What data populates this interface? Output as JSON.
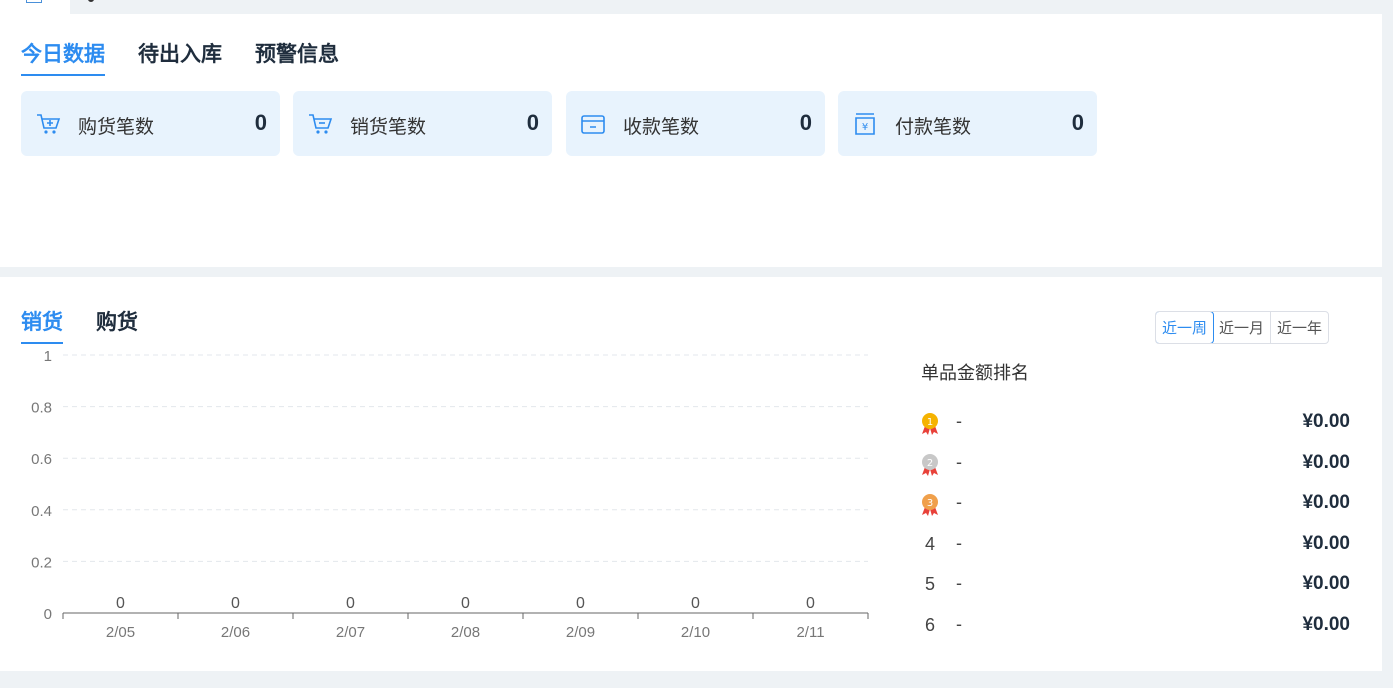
{
  "overview": {
    "tabs": [
      "今日数据",
      "待出入库",
      "预警信息"
    ],
    "stats": [
      {
        "label": "购货笔数",
        "value": "0",
        "icon": "cart-plus-icon"
      },
      {
        "label": "销货笔数",
        "value": "0",
        "icon": "cart-icon"
      },
      {
        "label": "收款笔数",
        "value": "0",
        "icon": "wallet-icon"
      },
      {
        "label": "付款笔数",
        "value": "0",
        "icon": "payment-yen-icon"
      }
    ]
  },
  "trend": {
    "tabs": [
      "销货",
      "购货"
    ],
    "range_options": [
      "近一周",
      "近一月",
      "近一年"
    ],
    "selected_range": "近一周"
  },
  "ranking": {
    "title": "单品金额排名",
    "rows": [
      {
        "rank": "1",
        "name": "-",
        "amount": "¥0.00"
      },
      {
        "rank": "2",
        "name": "-",
        "amount": "¥0.00"
      },
      {
        "rank": "3",
        "name": "-",
        "amount": "¥0.00"
      },
      {
        "rank": "4",
        "name": "-",
        "amount": "¥0.00"
      },
      {
        "rank": "5",
        "name": "-",
        "amount": "¥0.00"
      },
      {
        "rank": "6",
        "name": "-",
        "amount": "¥0.00"
      }
    ]
  },
  "colors": {
    "accent": "#2d8cf0",
    "stat_bg": "#e8f3fd",
    "gold": "#f5b301",
    "silver": "#c8c8c8",
    "bronze": "#f0a04b",
    "ribbon": "#e8413a"
  },
  "chart_data": {
    "type": "bar",
    "categories": [
      "2/05",
      "2/06",
      "2/07",
      "2/08",
      "2/09",
      "2/10",
      "2/11"
    ],
    "values": [
      0,
      0,
      0,
      0,
      0,
      0,
      0
    ],
    "data_labels": [
      "0",
      "0",
      "0",
      "0",
      "0",
      "0",
      "0"
    ],
    "y_ticks": [
      "0",
      "0.2",
      "0.4",
      "0.6",
      "0.8",
      "1"
    ],
    "ylim": [
      0,
      1
    ],
    "grid": true,
    "title": "",
    "xlabel": "",
    "ylabel": ""
  }
}
